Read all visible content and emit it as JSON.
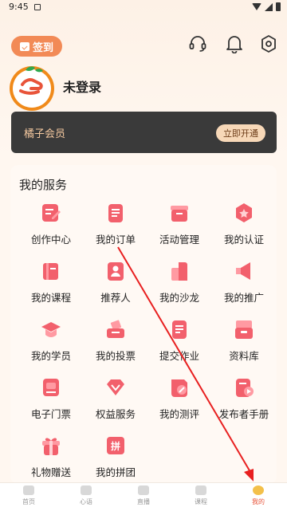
{
  "status_bar": {
    "time": "9:45"
  },
  "header": {
    "signin_label": "签到"
  },
  "profile": {
    "name": "未登录"
  },
  "vip": {
    "label": "橘子会员",
    "button": "立即开通"
  },
  "services": {
    "title": "我的服务",
    "items": [
      {
        "label": "创作中心",
        "icon": "edit-doc-icon"
      },
      {
        "label": "我的订单",
        "icon": "order-list-icon"
      },
      {
        "label": "活动管理",
        "icon": "activity-box-icon"
      },
      {
        "label": "我的认证",
        "icon": "certificate-icon"
      },
      {
        "label": "我的课程",
        "icon": "courses-icon"
      },
      {
        "label": "推荐人",
        "icon": "referrer-icon"
      },
      {
        "label": "我的沙龙",
        "icon": "salon-icon"
      },
      {
        "label": "我的推广",
        "icon": "megaphone-icon"
      },
      {
        "label": "我的学员",
        "icon": "graduation-cap-icon"
      },
      {
        "label": "我的投票",
        "icon": "ballot-box-icon"
      },
      {
        "label": "提交作业",
        "icon": "homework-icon"
      },
      {
        "label": "资料库",
        "icon": "archive-icon"
      },
      {
        "label": "电子门票",
        "icon": "ticket-icon"
      },
      {
        "label": "权益服务",
        "icon": "diamond-icon"
      },
      {
        "label": "我的测评",
        "icon": "assessment-icon"
      },
      {
        "label": "发布者手册",
        "icon": "video-manual-icon"
      },
      {
        "label": "礼物赠送",
        "icon": "gift-icon"
      },
      {
        "label": "我的拼团",
        "icon": "group-buy-icon"
      }
    ]
  },
  "group_buy_glyph": "拼",
  "bottom_nav": [
    {
      "label": "首页"
    },
    {
      "label": "心语"
    },
    {
      "label": "直播"
    },
    {
      "label": "课程"
    },
    {
      "label": "我的"
    }
  ],
  "colors": {
    "accent": "#f28a56",
    "icon_red": "#ef4f5f",
    "vip_bg": "#3a3a3a"
  }
}
